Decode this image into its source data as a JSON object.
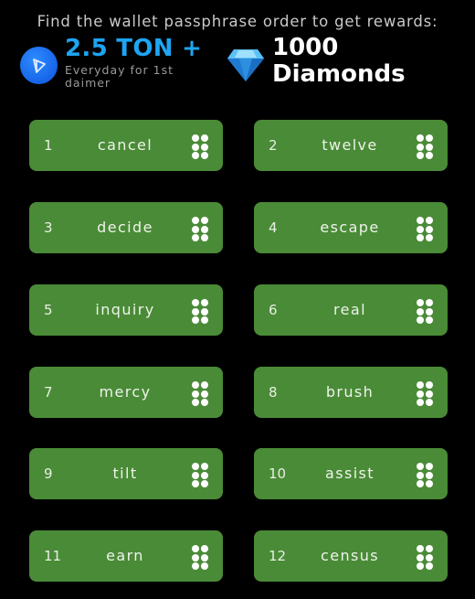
{
  "header": {
    "headline": "Find the wallet passphrase order to get rewards:",
    "reward_ton": {
      "icon": "ton-logo-icon",
      "amount": "2.5 TON +",
      "subtitle": "Everyday for 1st daimer",
      "color": "#1ea4f2"
    },
    "reward_diamonds": {
      "icon": "diamond-icon",
      "amount": "1000",
      "label": "Diamonds"
    }
  },
  "theme": {
    "card_color": "#4a8b37",
    "background": "#000000"
  },
  "words": [
    {
      "index": "1",
      "word": "cancel"
    },
    {
      "index": "2",
      "word": "twelve"
    },
    {
      "index": "3",
      "word": "decide"
    },
    {
      "index": "4",
      "word": "escape"
    },
    {
      "index": "5",
      "word": "inquiry"
    },
    {
      "index": "6",
      "word": "real"
    },
    {
      "index": "7",
      "word": "mercy"
    },
    {
      "index": "8",
      "word": "brush"
    },
    {
      "index": "9",
      "word": "tilt"
    },
    {
      "index": "10",
      "word": "assist"
    },
    {
      "index": "11",
      "word": "earn"
    },
    {
      "index": "12",
      "word": "census"
    }
  ]
}
